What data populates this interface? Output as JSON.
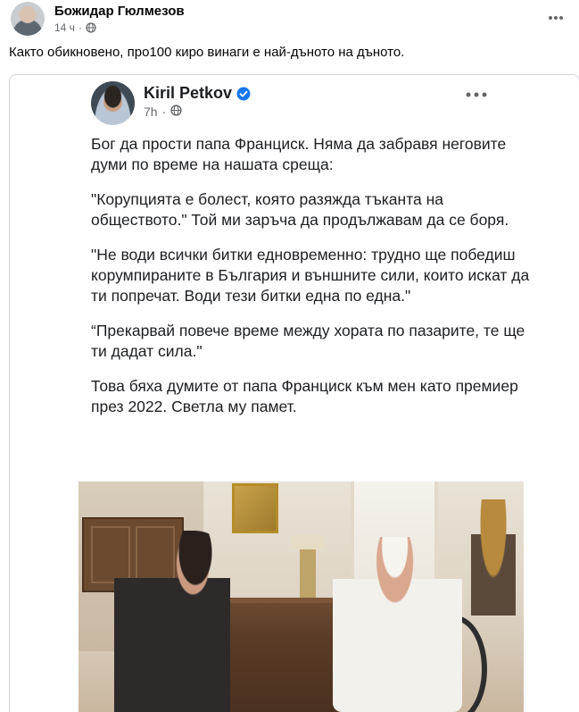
{
  "post": {
    "author": "Божидар Гюлмезов",
    "time": "14 ч",
    "separator": "·",
    "text": "Както обикновено, про100 киро винаги е най-дъното на дъното.",
    "more_icon": "more-horizontal-icon"
  },
  "embedded": {
    "author": "Kiril Petkov",
    "time": "7h",
    "separator": "·",
    "paragraphs": [
      "Бог да прости папа Франциск. Няма да забравя неговите думи по време на нашата среща:",
      "\"Корупцията е болест, която разяжда тъканта на обществото.\" Той ми заръча да продължавам да се боря.",
      "\"Не води всички битки едновременно: трудно ще победиш корумпираните в България и външните сили, които искат да ти попречат. Води тези битки една по една.\"",
      "“Прекарвай повече време между хората по пазарите, те ще ти дадат сила.\"",
      "Това бяха думите от папа Франциск към мен като премиер през 2022. Светла му памет."
    ]
  },
  "colors": {
    "verified": "#1877f2",
    "secondary_text": "#65676b",
    "card_border": "#cfd2d6"
  }
}
